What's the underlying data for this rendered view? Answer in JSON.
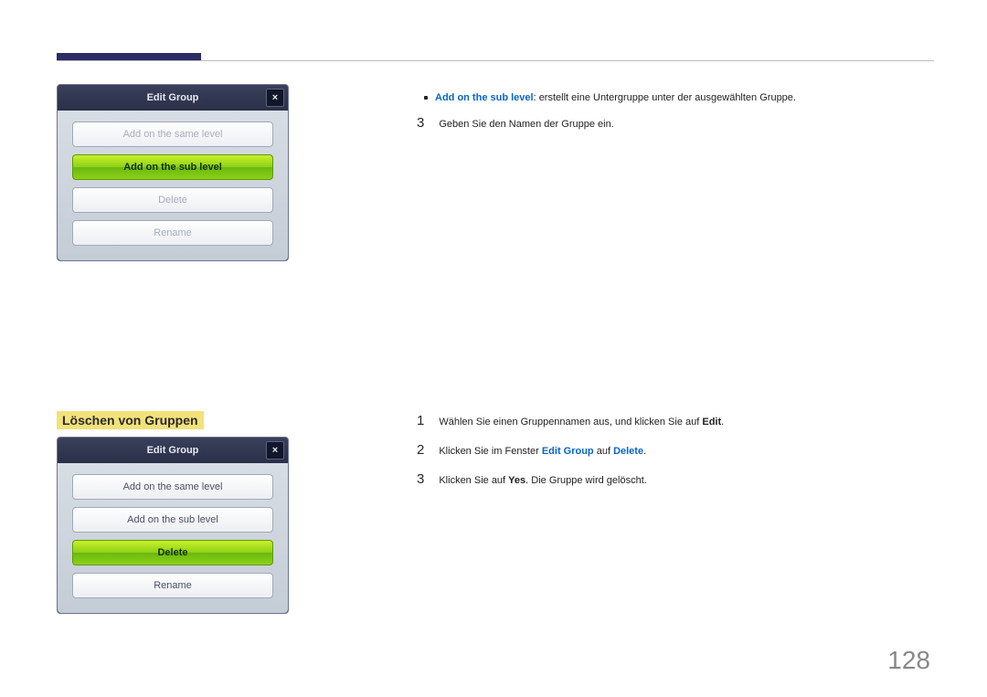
{
  "page_number": "128",
  "section_heading": "Löschen von Gruppen",
  "dialog1": {
    "title": "Edit Group",
    "close": "×",
    "buttons": {
      "same": "Add on the same level",
      "sub": "Add on the sub level",
      "delete": "Delete",
      "rename": "Rename"
    }
  },
  "dialog2": {
    "title": "Edit Group",
    "close": "×",
    "buttons": {
      "same": "Add on the same level",
      "sub": "Add on the sub level",
      "delete": "Delete",
      "rename": "Rename"
    }
  },
  "bullet": {
    "label": "Add on the sub level",
    "text": ": erstellt eine Untergruppe unter der ausgewählten Gruppe."
  },
  "top_step3": {
    "num": "3",
    "text": "Geben Sie den Namen der Gruppe ein."
  },
  "steps": {
    "s1": {
      "num": "1",
      "pre": "Wählen Sie einen Gruppennamen aus, und klicken Sie auf ",
      "bold1": "Edit",
      "post": "."
    },
    "s2": {
      "num": "2",
      "t1": "Klicken Sie im Fenster ",
      "b1": "Edit Group",
      "t2": " auf ",
      "b2": "Delete",
      "t3": "."
    },
    "s3": {
      "num": "3",
      "t1": "Klicken Sie auf ",
      "b1": "Yes",
      "t2": ". Die Gruppe wird gelöscht."
    }
  }
}
